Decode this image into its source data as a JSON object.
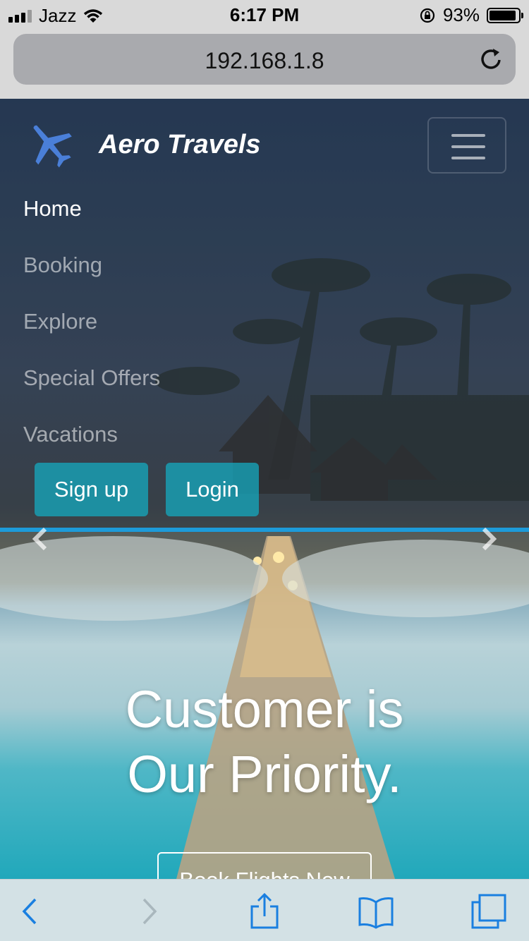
{
  "status_bar": {
    "carrier": "Jazz",
    "time": "6:17 PM",
    "battery_percent": "93%",
    "battery_level": 0.93
  },
  "browser": {
    "address": "192.168.1.8",
    "reload_icon": "reload-icon"
  },
  "navbar": {
    "brand_name": "Aero Travels",
    "logo_icon": "airplane-icon",
    "toggle_icon": "hamburger-icon",
    "links": [
      {
        "label": "Home",
        "active": true
      },
      {
        "label": "Booking",
        "active": false
      },
      {
        "label": "Explore",
        "active": false
      },
      {
        "label": "Special Offers",
        "active": false
      },
      {
        "label": "Vacations",
        "active": false
      }
    ],
    "signup_label": "Sign up",
    "login_label": "Login"
  },
  "hero": {
    "headline_line1": "Customer is",
    "headline_line2": "Our Priority.",
    "cta_label": "Book Flights Now"
  },
  "toolbar": {
    "icons": [
      "back-icon",
      "forward-icon",
      "share-icon",
      "bookmarks-icon",
      "tabs-icon"
    ]
  },
  "colors": {
    "accent": "#17a2b8",
    "carousel_bar": "#1d9bd9",
    "toolbar_icon": "#1a7fe0",
    "logo_blue": "#4a7fd8"
  }
}
